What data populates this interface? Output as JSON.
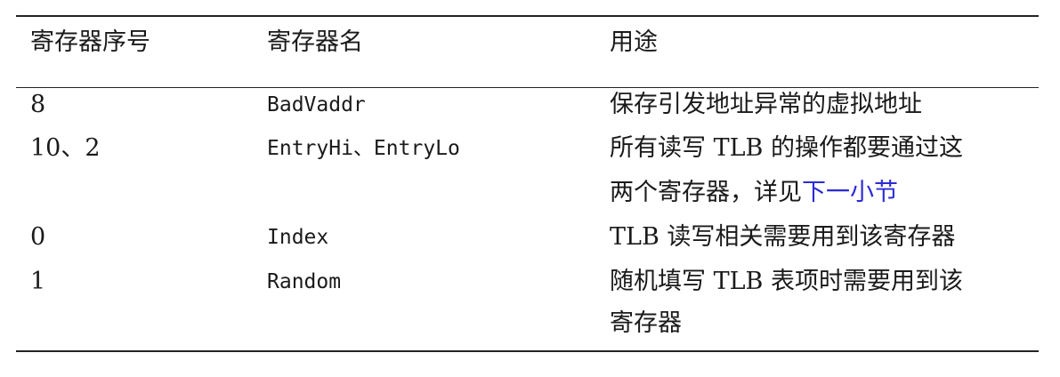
{
  "table": {
    "headers": [
      "寄存器序号",
      "寄存器名",
      "用途"
    ],
    "rows": [
      {
        "number": "8",
        "name": "BadVaddr",
        "purpose_lines": [
          "保存引发地址异常的虚拟地址"
        ]
      },
      {
        "number": "10、2",
        "name": "EntryHi、EntryLo",
        "purpose_lines": [
          "所有读写 TLB 的操作都要通过这",
          "两个寄存器，详见"
        ],
        "purpose_link": "下一小节"
      },
      {
        "number": "0",
        "name": "Index",
        "purpose_lines": [
          "TLB 读写相关需要用到该寄存器"
        ]
      },
      {
        "number": "1",
        "name": "Random",
        "purpose_lines": [
          "随机填写 TLB 表项时需要用到该",
          "寄存器"
        ]
      }
    ]
  },
  "colors": {
    "text": "#1a1a1a",
    "link": "#2b2bd6",
    "rule": "#222222"
  }
}
